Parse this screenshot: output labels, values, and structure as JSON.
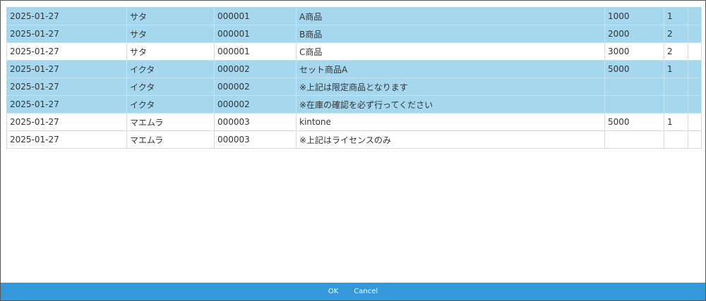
{
  "table": {
    "rows": [
      {
        "date": "2025-01-27",
        "name": "サタ",
        "code": "000001",
        "item": "A商品",
        "amount": "1000",
        "qty": "1",
        "selected": true
      },
      {
        "date": "2025-01-27",
        "name": "サタ",
        "code": "000001",
        "item": "B商品",
        "amount": "2000",
        "qty": "2",
        "selected": true
      },
      {
        "date": "2025-01-27",
        "name": "サタ",
        "code": "000001",
        "item": "C商品",
        "amount": "3000",
        "qty": "2",
        "selected": false
      },
      {
        "date": "2025-01-27",
        "name": "イクタ",
        "code": "000002",
        "item": "セット商品A",
        "amount": "5000",
        "qty": "1",
        "selected": true
      },
      {
        "date": "2025-01-27",
        "name": "イクタ",
        "code": "000002",
        "item": "※上記は限定商品となります",
        "amount": "",
        "qty": "",
        "selected": true
      },
      {
        "date": "2025-01-27",
        "name": "イクタ",
        "code": "000002",
        "item": "※在庫の確認を必ず行ってください",
        "amount": "",
        "qty": "",
        "selected": true
      },
      {
        "date": "2025-01-27",
        "name": "マエムラ",
        "code": "000003",
        "item": "kintone",
        "amount": "5000",
        "qty": "1",
        "selected": false
      },
      {
        "date": "2025-01-27",
        "name": "マエムラ",
        "code": "000003",
        "item": "※上記はライセンスのみ",
        "amount": "",
        "qty": "",
        "selected": false
      }
    ]
  },
  "footer": {
    "ok_label": "OK",
    "cancel_label": "Cancel"
  },
  "colors": {
    "selected_row": "#a5d8ee",
    "footer_bar": "#3498db"
  }
}
